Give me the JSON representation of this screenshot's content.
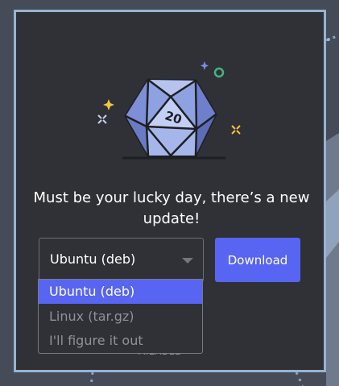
{
  "dialog": {
    "message": "Must be your lucky day, there’s a new update!",
    "illustration_icon": "d20-dice",
    "dice_number": "20"
  },
  "platform_select": {
    "value": "Ubuntu (deb)",
    "options": [
      {
        "label": "Ubuntu (deb)",
        "selected": true
      },
      {
        "label": "Linux (tar.gz)",
        "selected": false
      },
      {
        "label": "I'll figure it out",
        "selected": false
      }
    ]
  },
  "download_button": {
    "label": "Download"
  },
  "footer": {
    "partial_text": "AILABLE"
  },
  "colors": {
    "background": "#454b57",
    "modal_bg": "#2f3136",
    "modal_border": "#97b3d1",
    "accent": "#5865f2",
    "muted_text": "#8e9297"
  }
}
